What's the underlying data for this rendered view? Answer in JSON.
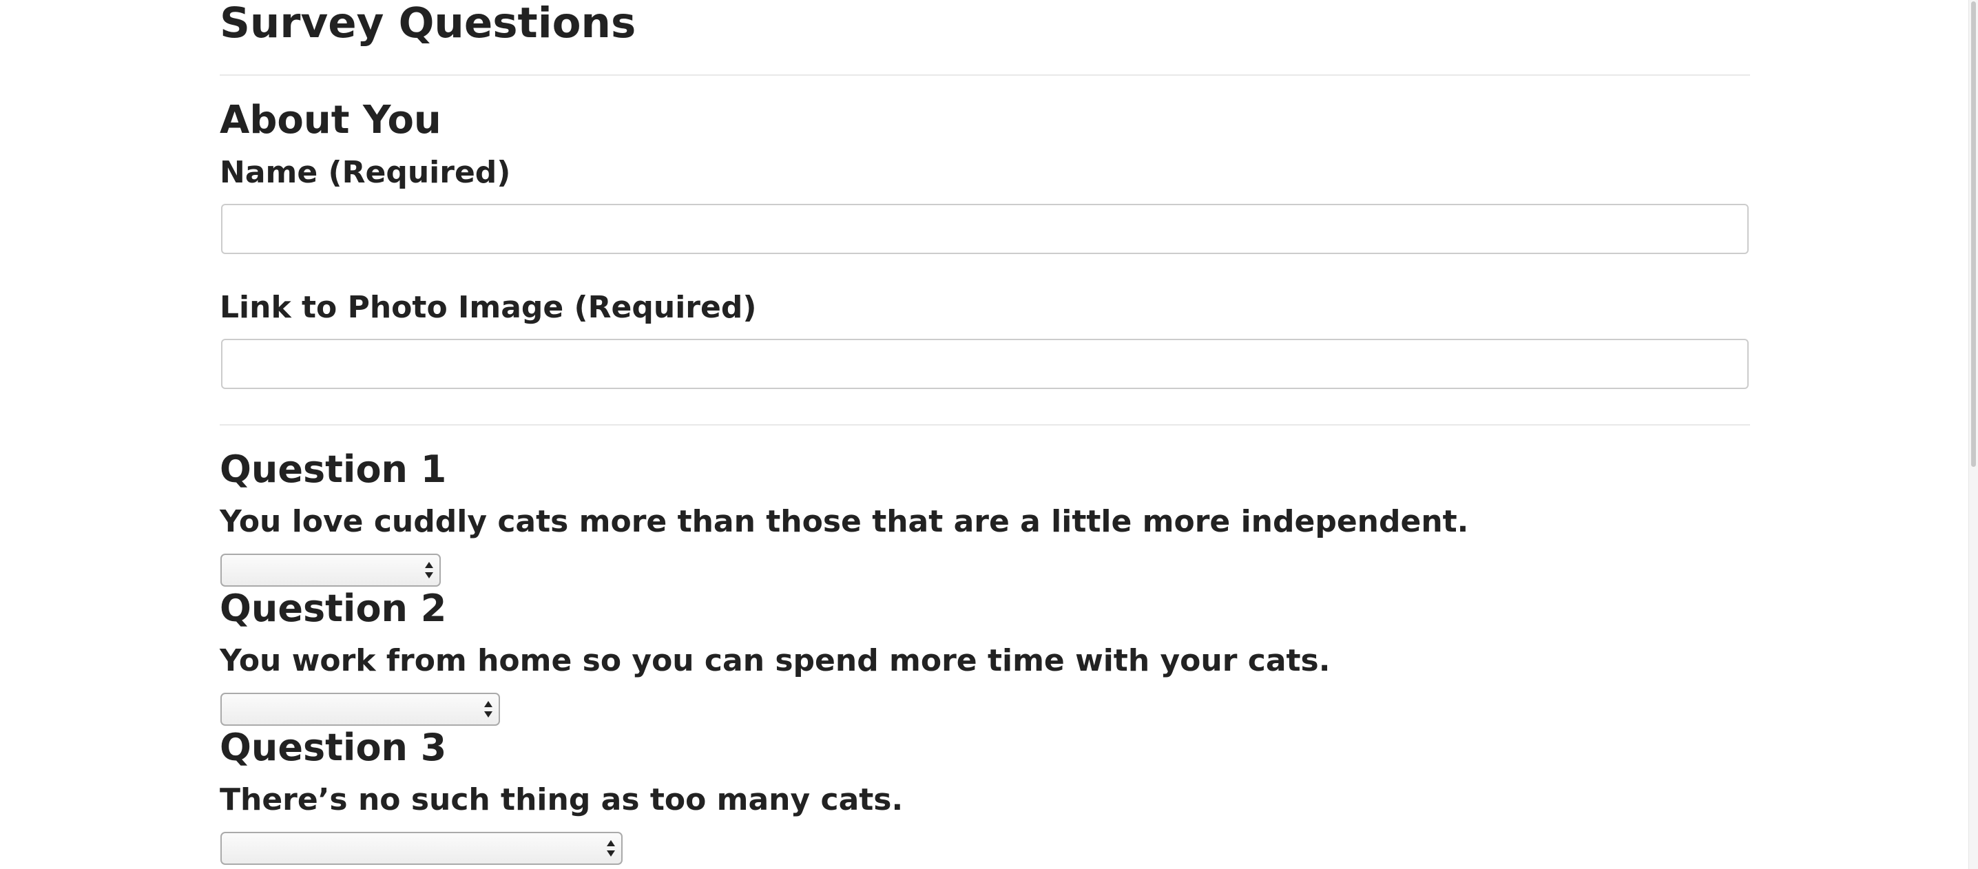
{
  "page": {
    "title": "Survey Questions"
  },
  "about": {
    "heading": "About You",
    "name_label": "Name (Required)",
    "name_value": "",
    "photo_label": "Link to Photo Image (Required)",
    "photo_value": ""
  },
  "questions": [
    {
      "title": "Question 1",
      "text": "You love cuddly cats more than those that are a little more independent.",
      "selected": ""
    },
    {
      "title": "Question 2",
      "text": "You work from home so you can spend more time with your cats.",
      "selected": ""
    },
    {
      "title": "Question 3",
      "text": "There’s no such thing as too many cats.",
      "selected": ""
    }
  ],
  "icons": {
    "select_arrows": "up-down-arrows-icon"
  },
  "colors": {
    "text": "#222222",
    "divider": "#e8e8e8",
    "input_border": "#cccccc"
  }
}
